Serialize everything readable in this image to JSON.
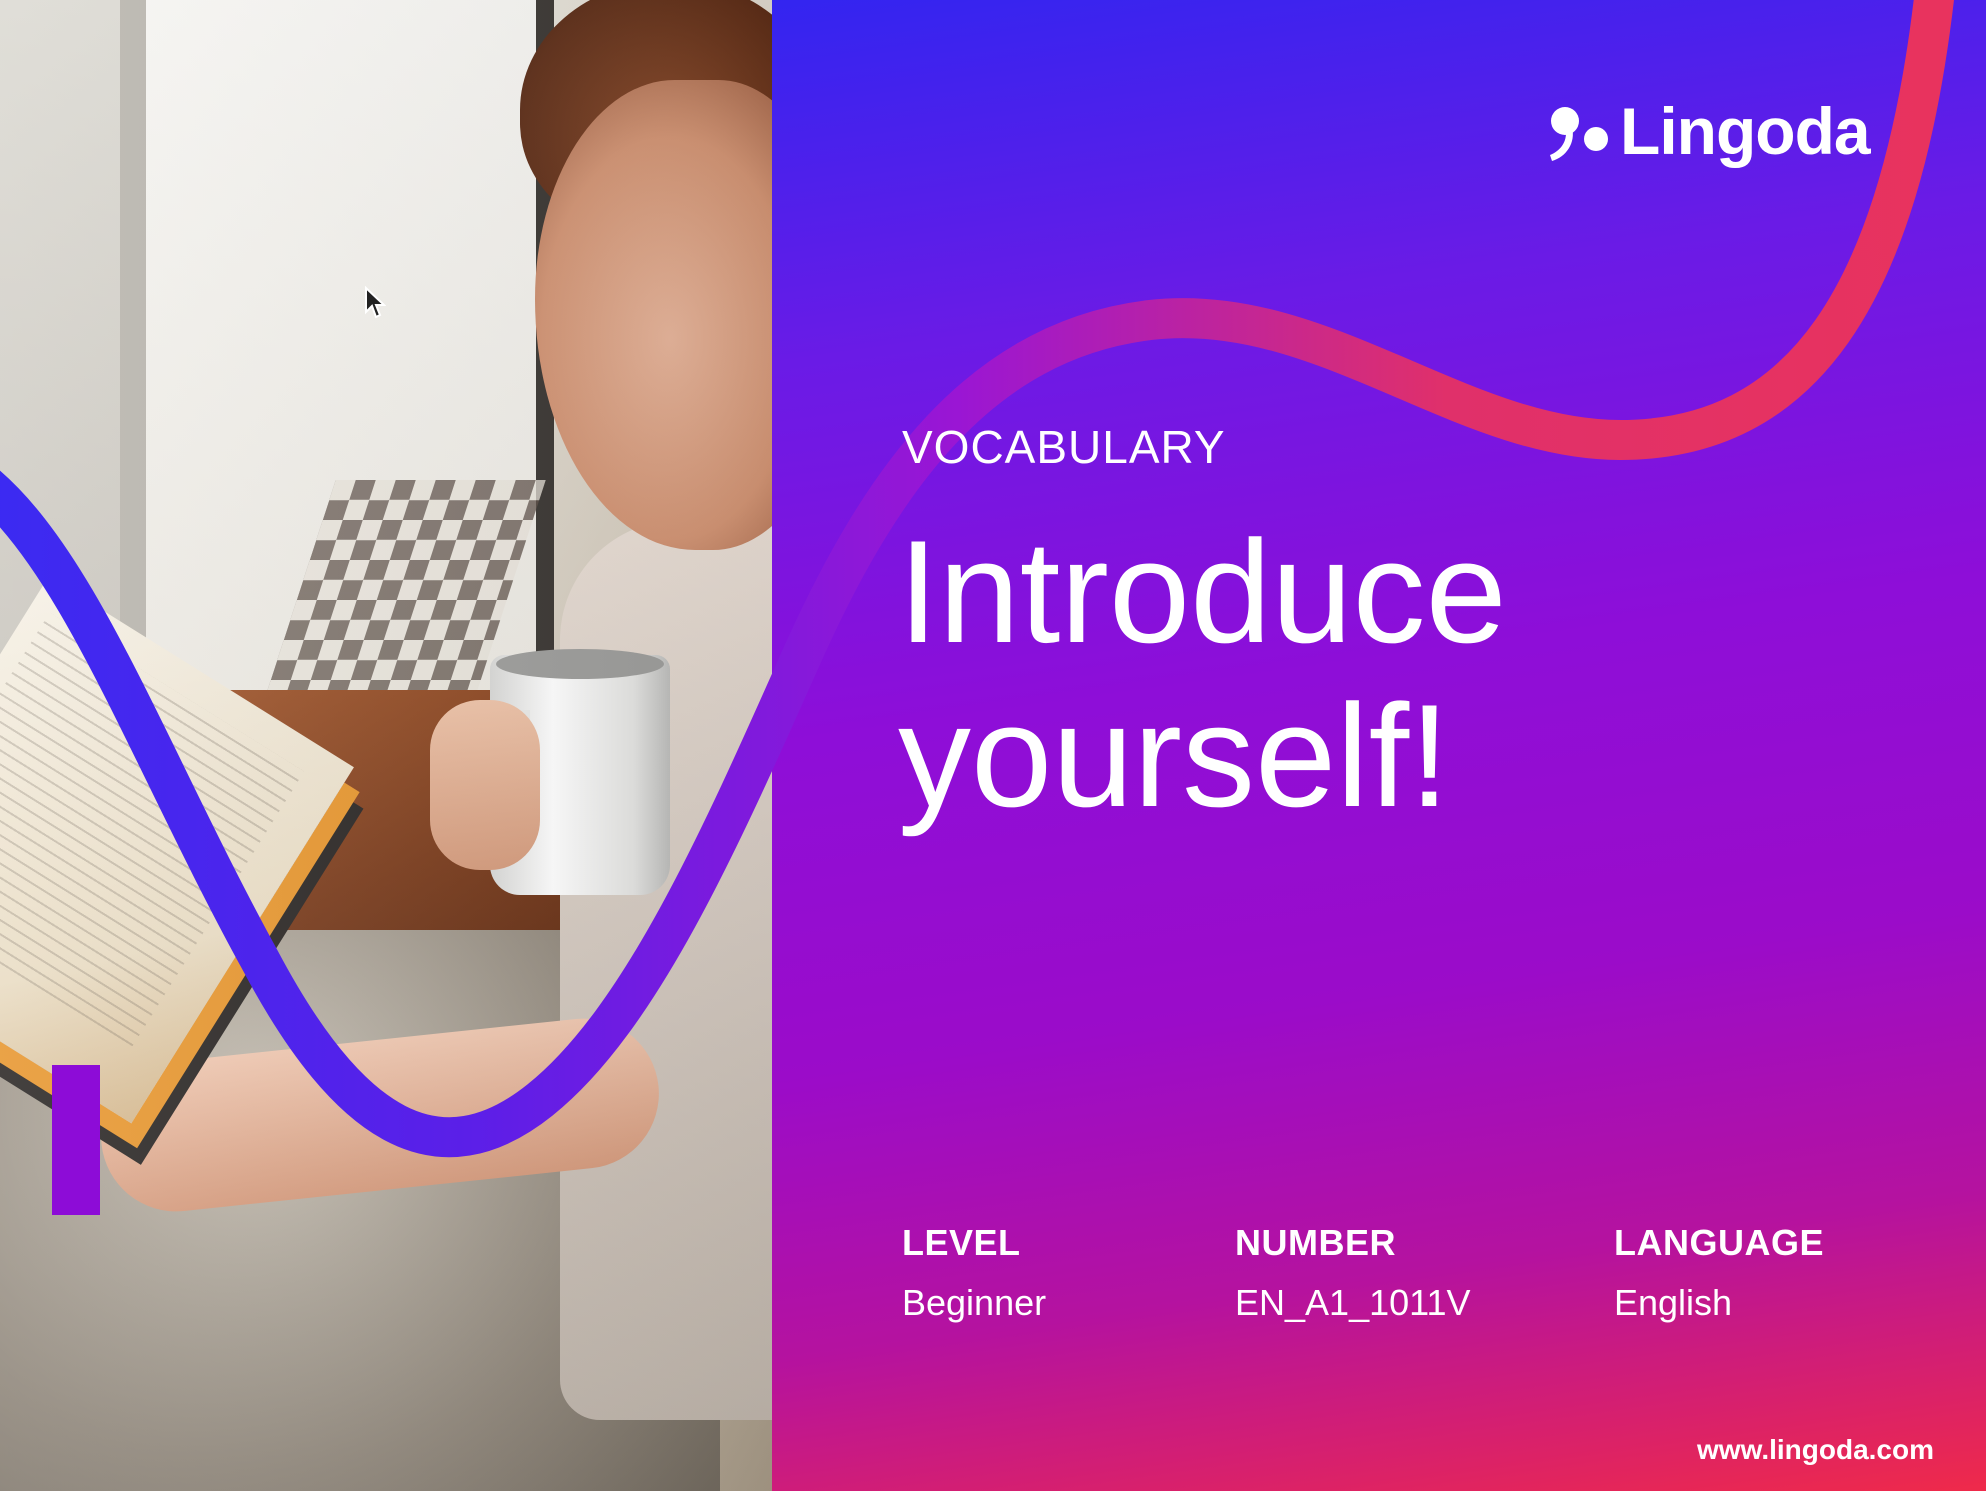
{
  "brand": {
    "name": "Lingoda",
    "logo_icon": "lingoda-comma-dot-icon",
    "url": "www.lingoda.com"
  },
  "lesson": {
    "category": "VOCABULARY",
    "title_line1": "Introduce",
    "title_line2": "yourself!"
  },
  "meta": {
    "level": {
      "label": "LEVEL",
      "value": "Beginner"
    },
    "number": {
      "label": "NUMBER",
      "value": "EN_A1_1011V"
    },
    "language": {
      "label": "LANGUAGE",
      "value": "English"
    }
  },
  "colors": {
    "gradient_top": "#3325f0",
    "gradient_mid": "#9b0cc9",
    "gradient_bottom": "#ef2a4a",
    "accent_bar": "#8d0cd7",
    "text": "#ffffff"
  },
  "photo": {
    "icon": "woman-reading-book-with-mug-photo"
  },
  "cursor": {
    "icon": "mouse-pointer-icon"
  }
}
